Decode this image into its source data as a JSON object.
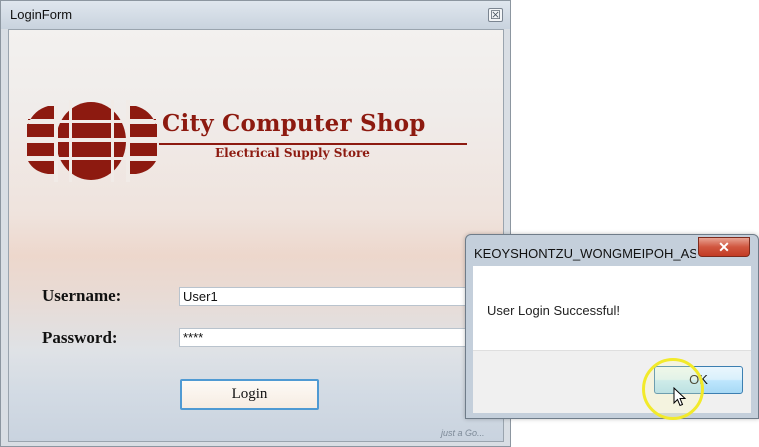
{
  "login_window": {
    "title": "LoginForm",
    "close_glyph": "☒",
    "logo": {
      "title": "City Computer Shop",
      "subtitle": "Electrical Supply Store",
      "color": "#8d1a10"
    },
    "username_label": "Username:",
    "username_value": "User1",
    "password_label": "Password:",
    "password_value": "****",
    "login_label": "Login",
    "watermark": "just a Go..."
  },
  "message_box": {
    "title": "KEOYSHONTZU_WONGMEIPOH_AS...",
    "close_glyph": "✕",
    "message": "User Login Successful!",
    "ok_label": "OK"
  },
  "icons": {
    "logo": "globe-logo-icon",
    "cursor": "mouse-pointer-icon",
    "close": "close-icon"
  }
}
